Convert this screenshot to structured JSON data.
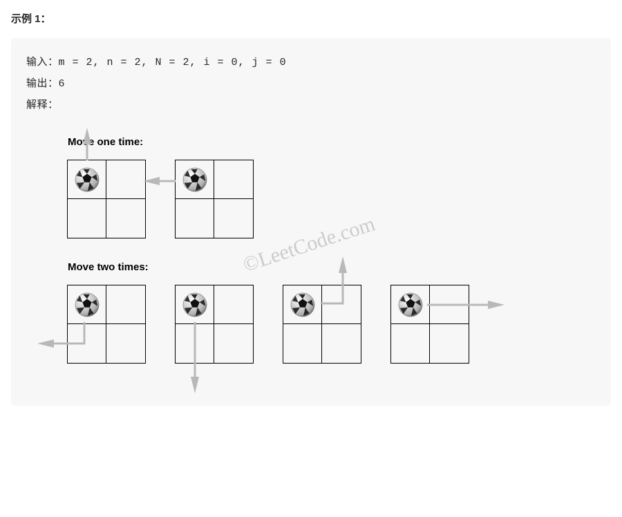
{
  "example": {
    "heading": "示例 1：",
    "input_label": "输入：",
    "input_value": "m = 2, n = 2, N = 2, i = 0, j = 0",
    "output_label": "输出：",
    "output_value": "6",
    "explain_label": "解释："
  },
  "diagram": {
    "label_one_move": "Move one time:",
    "label_two_moves": "Move two times:",
    "watermark": "©LeetCode.com"
  }
}
